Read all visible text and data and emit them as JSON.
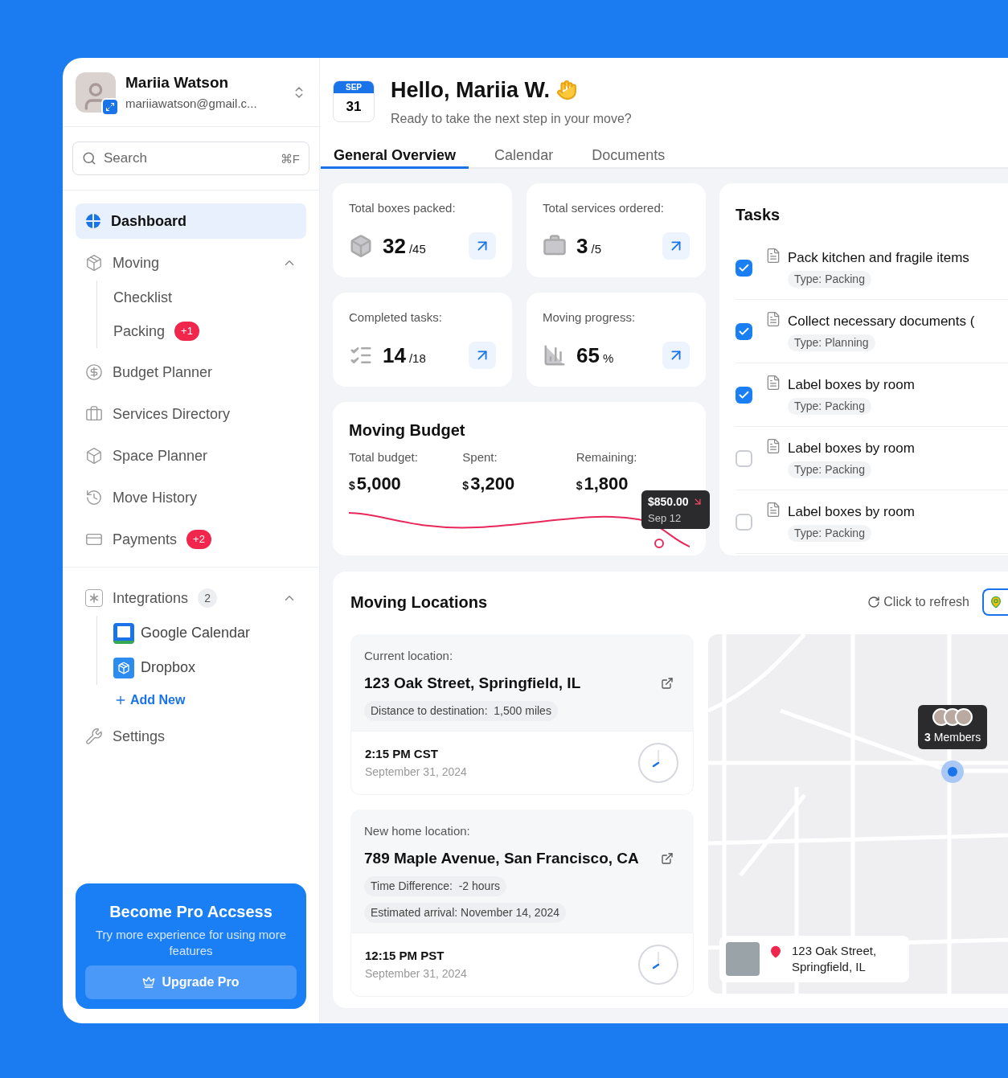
{
  "user": {
    "name": "Mariia Watson",
    "email": "mariiawatson@gmail.c..."
  },
  "search": {
    "placeholder": "Search",
    "shortcut": "⌘F"
  },
  "nav": [
    {
      "kind": "item",
      "label": "Dashboard",
      "selected": true
    },
    {
      "kind": "group",
      "label": "Moving",
      "selected": false,
      "expanded": true,
      "children": [
        {
          "label": "Checklist"
        },
        {
          "label": "Packing",
          "badge": "+1"
        }
      ]
    },
    {
      "kind": "item",
      "label": "Budget Planner",
      "selected": false
    },
    {
      "kind": "item",
      "label": "Services Directory",
      "selected": false
    },
    {
      "kind": "item",
      "label": "Space Planner",
      "selected": false
    },
    {
      "kind": "item",
      "label": "Move History",
      "selected": false
    },
    {
      "kind": "item",
      "label": "Payments",
      "selected": false,
      "badge": "+2"
    }
  ],
  "integrations": {
    "label": "Integrations",
    "count": "2",
    "expanded": true,
    "items": [
      {
        "label": "Google Calendar"
      },
      {
        "label": "Dropbox"
      }
    ],
    "add_label": "Add New"
  },
  "settings": {
    "label": "Settings"
  },
  "promo": {
    "title": "Become Pro Accsess",
    "text": "Try more experience for using more features",
    "button": "Upgrade Pro"
  },
  "header": {
    "month": "SEP",
    "day": "31",
    "greeting": "Hello, Mariia W.",
    "subtitle": "Ready to take the next step in your move?"
  },
  "tabs": [
    {
      "label": "General Overview",
      "selected": true
    },
    {
      "label": "Calendar",
      "selected": false
    },
    {
      "label": "Documents",
      "selected": false
    }
  ],
  "stats": [
    {
      "label": "Total boxes packed:",
      "value": "32",
      "total": "/45"
    },
    {
      "label": "Total services ordered:",
      "value": "3",
      "total": "/5"
    },
    {
      "label": "Completed tasks:",
      "value": "14",
      "total": "/18"
    },
    {
      "label": "Moving progress:",
      "value": "65",
      "total": "%"
    }
  ],
  "budget": {
    "title": "Moving Budget",
    "items": [
      {
        "label": "Total budget:",
        "currency": "$",
        "amount": "5,000"
      },
      {
        "label": "Spent:",
        "currency": "$",
        "amount": "3,200"
      },
      {
        "label": "Remaining:",
        "currency": "$",
        "amount": "1,800"
      }
    ],
    "tooltip": {
      "value": "$850.00",
      "date": "Sep 12"
    }
  },
  "tasks": {
    "title": "Tasks",
    "items": [
      {
        "title": "Pack kitchen and fragile items",
        "type": "Type: Packing",
        "checked": true
      },
      {
        "title": "Collect necessary documents (",
        "type": "Type: Planning",
        "checked": true
      },
      {
        "title": "Label boxes by room",
        "type": "Type: Packing",
        "checked": true
      },
      {
        "title": "Label boxes by room",
        "type": "Type: Packing",
        "checked": false
      },
      {
        "title": "Label boxes by room",
        "type": "Type: Packing",
        "checked": false
      }
    ]
  },
  "locations": {
    "title": "Moving Locations",
    "refresh": "Click to refresh",
    "cards": [
      {
        "label": "Current location:",
        "address": "123 Oak Street, Springfield, IL",
        "chips": [
          "Distance to destination:  1,500 miles"
        ],
        "time": "2:15 PM CST",
        "date": "September 31, 2024"
      },
      {
        "label": "New home location:",
        "address": "789 Maple Avenue, San Francisco, CA",
        "chips": [
          "Time Difference:  -2 hours",
          "Estimated arrival: November 14, 2024"
        ],
        "time": "12:15 PM PST",
        "date": "September 31, 2024"
      }
    ],
    "map": {
      "members_count": "3",
      "members_label": "Members",
      "address": "123 Oak Street, Springfield, IL"
    }
  }
}
